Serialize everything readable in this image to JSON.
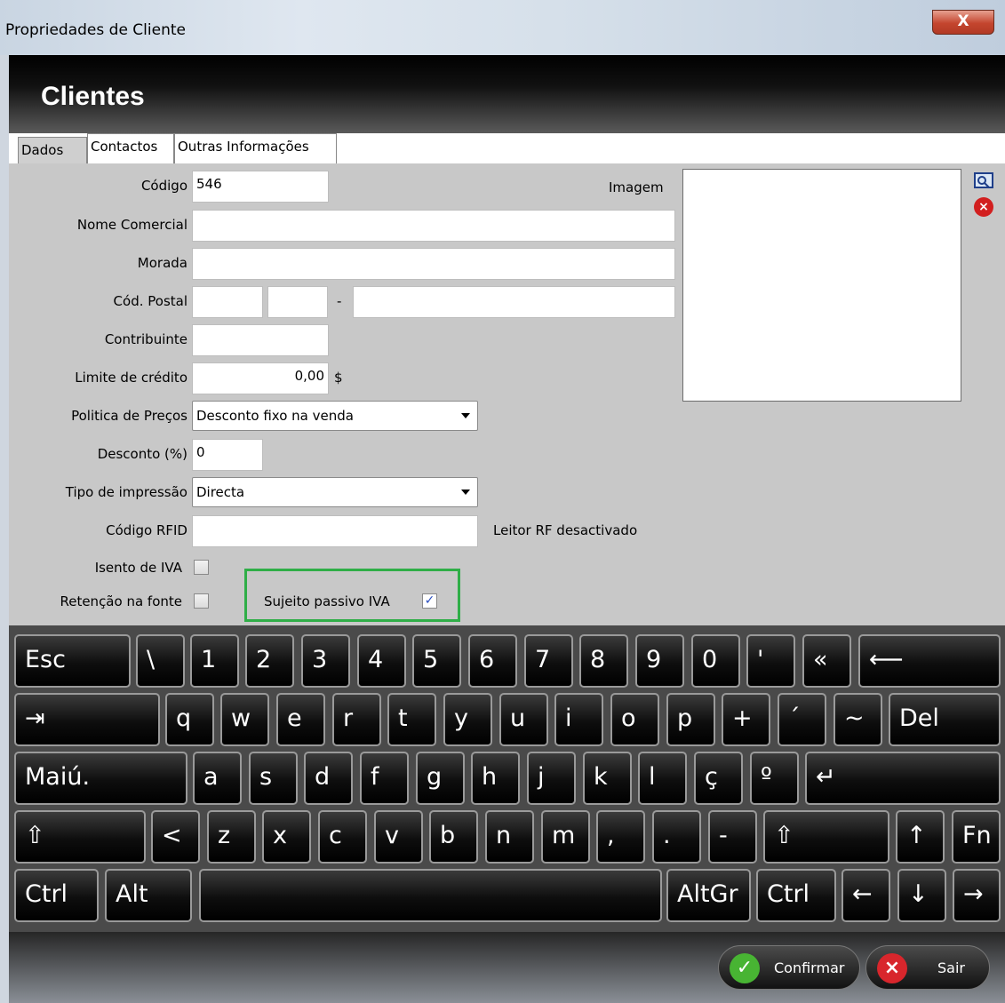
{
  "window": {
    "title": "Propriedades de Cliente",
    "close_label": "X"
  },
  "header": {
    "title": "Clientes"
  },
  "tabs": [
    {
      "label": "Dados"
    },
    {
      "label": "Contactos"
    },
    {
      "label": "Outras Informações"
    }
  ],
  "form": {
    "codigo": {
      "label": "Código",
      "value": "546"
    },
    "nome_comercial": {
      "label": "Nome Comercial",
      "value": ""
    },
    "morada": {
      "label": "Morada",
      "value": ""
    },
    "cod_postal": {
      "label": "Cód. Postal",
      "separator": "-",
      "part1": "",
      "part2": "",
      "locality": ""
    },
    "contribuinte": {
      "label": "Contribuinte",
      "value": ""
    },
    "limite_credito": {
      "label": "Limite de crédito",
      "value": "0,00",
      "currency": "$"
    },
    "politica_precos": {
      "label": "Politica de Preços",
      "value": "Desconto fixo na venda"
    },
    "desconto": {
      "label": "Desconto (%)",
      "value": "0"
    },
    "tipo_impressao": {
      "label": "Tipo de impressão",
      "value": "Directa"
    },
    "codigo_rfid": {
      "label": "Código RFID",
      "value": "",
      "status": "Leitor RF desactivado"
    },
    "isento_iva": {
      "label": "Isento de IVA",
      "checked": false
    },
    "retencao_fonte": {
      "label": "Retenção na fonte",
      "checked": false
    },
    "sujeito_passivo": {
      "label": "Sujeito passivo IVA",
      "checked": true,
      "mark": "✓"
    },
    "imagem": {
      "label": "Imagem"
    }
  },
  "keyboard": {
    "row1": [
      "Esc",
      "\\",
      "1",
      "2",
      "3",
      "4",
      "5",
      "6",
      "7",
      "8",
      "9",
      "0",
      "'",
      "«",
      "⟵"
    ],
    "row2": [
      "⇥",
      "q",
      "w",
      "e",
      "r",
      "t",
      "y",
      "u",
      "i",
      "o",
      "p",
      "+",
      "´",
      "~",
      "Del"
    ],
    "row3": [
      "Maiú.",
      "a",
      "s",
      "d",
      "f",
      "g",
      "h",
      "j",
      "k",
      "l",
      "ç",
      "º",
      "↵"
    ],
    "row4": [
      "⇧",
      "<",
      "z",
      "x",
      "c",
      "v",
      "b",
      "n",
      "m",
      ",",
      ".",
      "-",
      "⇧",
      "↑",
      "Fn"
    ],
    "row5": [
      "Ctrl",
      "Alt",
      "",
      "AltGr",
      "Ctrl",
      "←",
      "↓",
      "→"
    ]
  },
  "footer": {
    "confirm_label": "Confirmar",
    "exit_label": "Sair"
  },
  "colors": {
    "highlight": "#2fae47",
    "confirm": "#48b433",
    "exit": "#d8262c"
  }
}
